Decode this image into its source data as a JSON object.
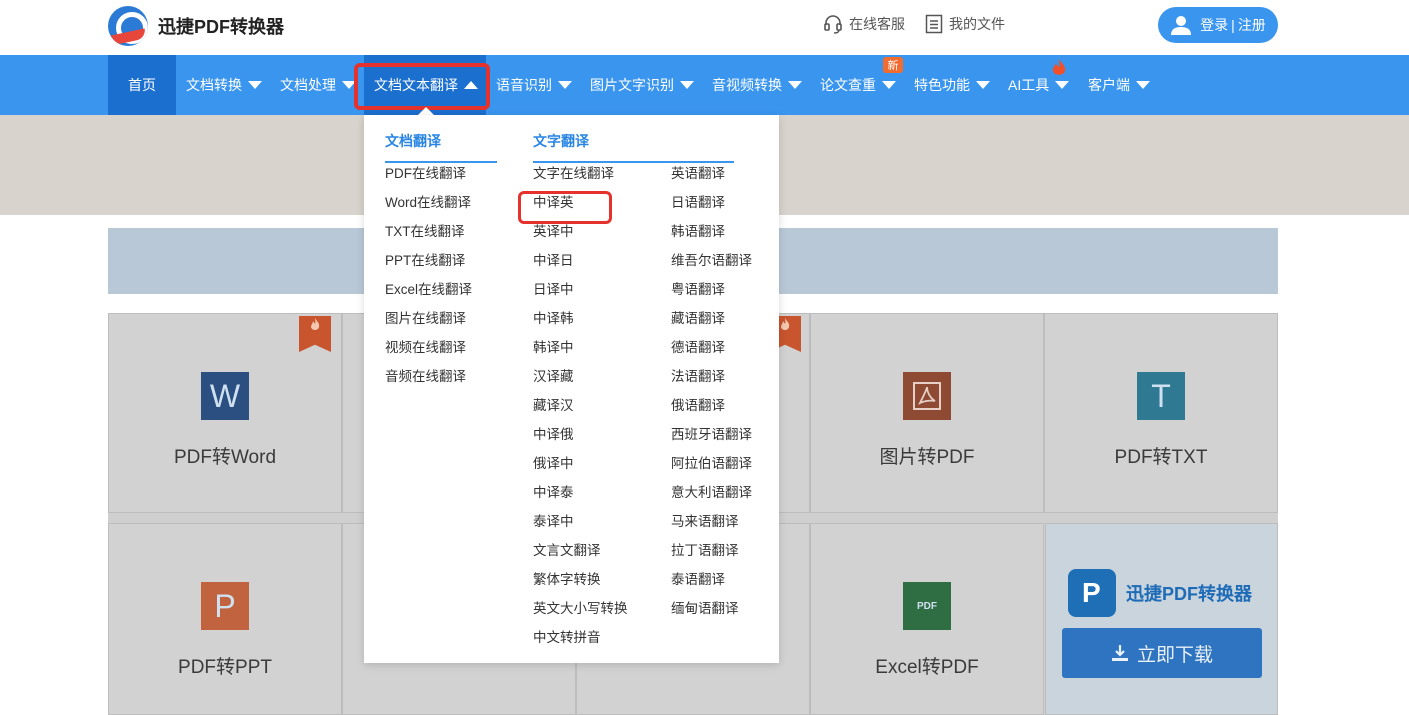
{
  "header": {
    "app_name": "迅捷PDF转换器",
    "service": "在线客服",
    "my_files": "我的文件",
    "login": "登录",
    "separator": "|",
    "register": "注册"
  },
  "nav": {
    "items": [
      {
        "label": "首页"
      },
      {
        "label": "文档转换"
      },
      {
        "label": "文档处理"
      },
      {
        "label": "文档文本翻译"
      },
      {
        "label": "语音识别"
      },
      {
        "label": "图片文字识别"
      },
      {
        "label": "音视频转换"
      },
      {
        "label": "论文查重"
      },
      {
        "label": "特色功能"
      },
      {
        "label": "AI工具"
      },
      {
        "label": "客户端"
      }
    ],
    "new_badge": "新",
    "active_color": "#1b6fce",
    "bar_color": "#3a95ef"
  },
  "dropdown": {
    "doc_translate": {
      "heading": "文档翻译",
      "items": [
        "PDF在线翻译",
        "Word在线翻译",
        "TXT在线翻译",
        "PPT在线翻译",
        "Excel在线翻译",
        "图片在线翻译",
        "视频在线翻译",
        "音频在线翻译"
      ]
    },
    "text_translate": {
      "heading": "文字翻译",
      "col1": [
        "文字在线翻译",
        "中译英",
        "英译中",
        "中译日",
        "日译中",
        "中译韩",
        "韩译中",
        "汉译藏",
        "藏译汉",
        "中译俄",
        "俄译中",
        "中译泰",
        "泰译中",
        "文言文翻译",
        "繁体字转换",
        "英文大小写转换",
        "中文转拼音"
      ],
      "col2": [
        "英语翻译",
        "日语翻译",
        "韩语翻译",
        "维吾尔语翻译",
        "粤语翻译",
        "藏语翻译",
        "德语翻译",
        "法语翻译",
        "俄语翻译",
        "西班牙语翻译",
        "阿拉伯语翻译",
        "意大利语翻译",
        "马来语翻译",
        "拉丁语翻译",
        "泰语翻译",
        "缅甸语翻译"
      ]
    }
  },
  "cards": [
    {
      "label": "PDF转Word",
      "icon": "W",
      "color": "#2b579a"
    },
    {
      "label": "图片转PDF",
      "icon": "pdf-icon",
      "color": "#b7472a"
    },
    {
      "label": "PDF转TXT",
      "icon": "T",
      "color": "#2a8fb0"
    },
    {
      "label": "PDF转PPT",
      "icon": "P",
      "color": "#d24726"
    },
    {
      "label": "Excel转PDF",
      "icon": "PDF",
      "color": "#217346"
    }
  ],
  "download": {
    "brand": "迅捷PDF转换器",
    "button": "立即下载"
  }
}
